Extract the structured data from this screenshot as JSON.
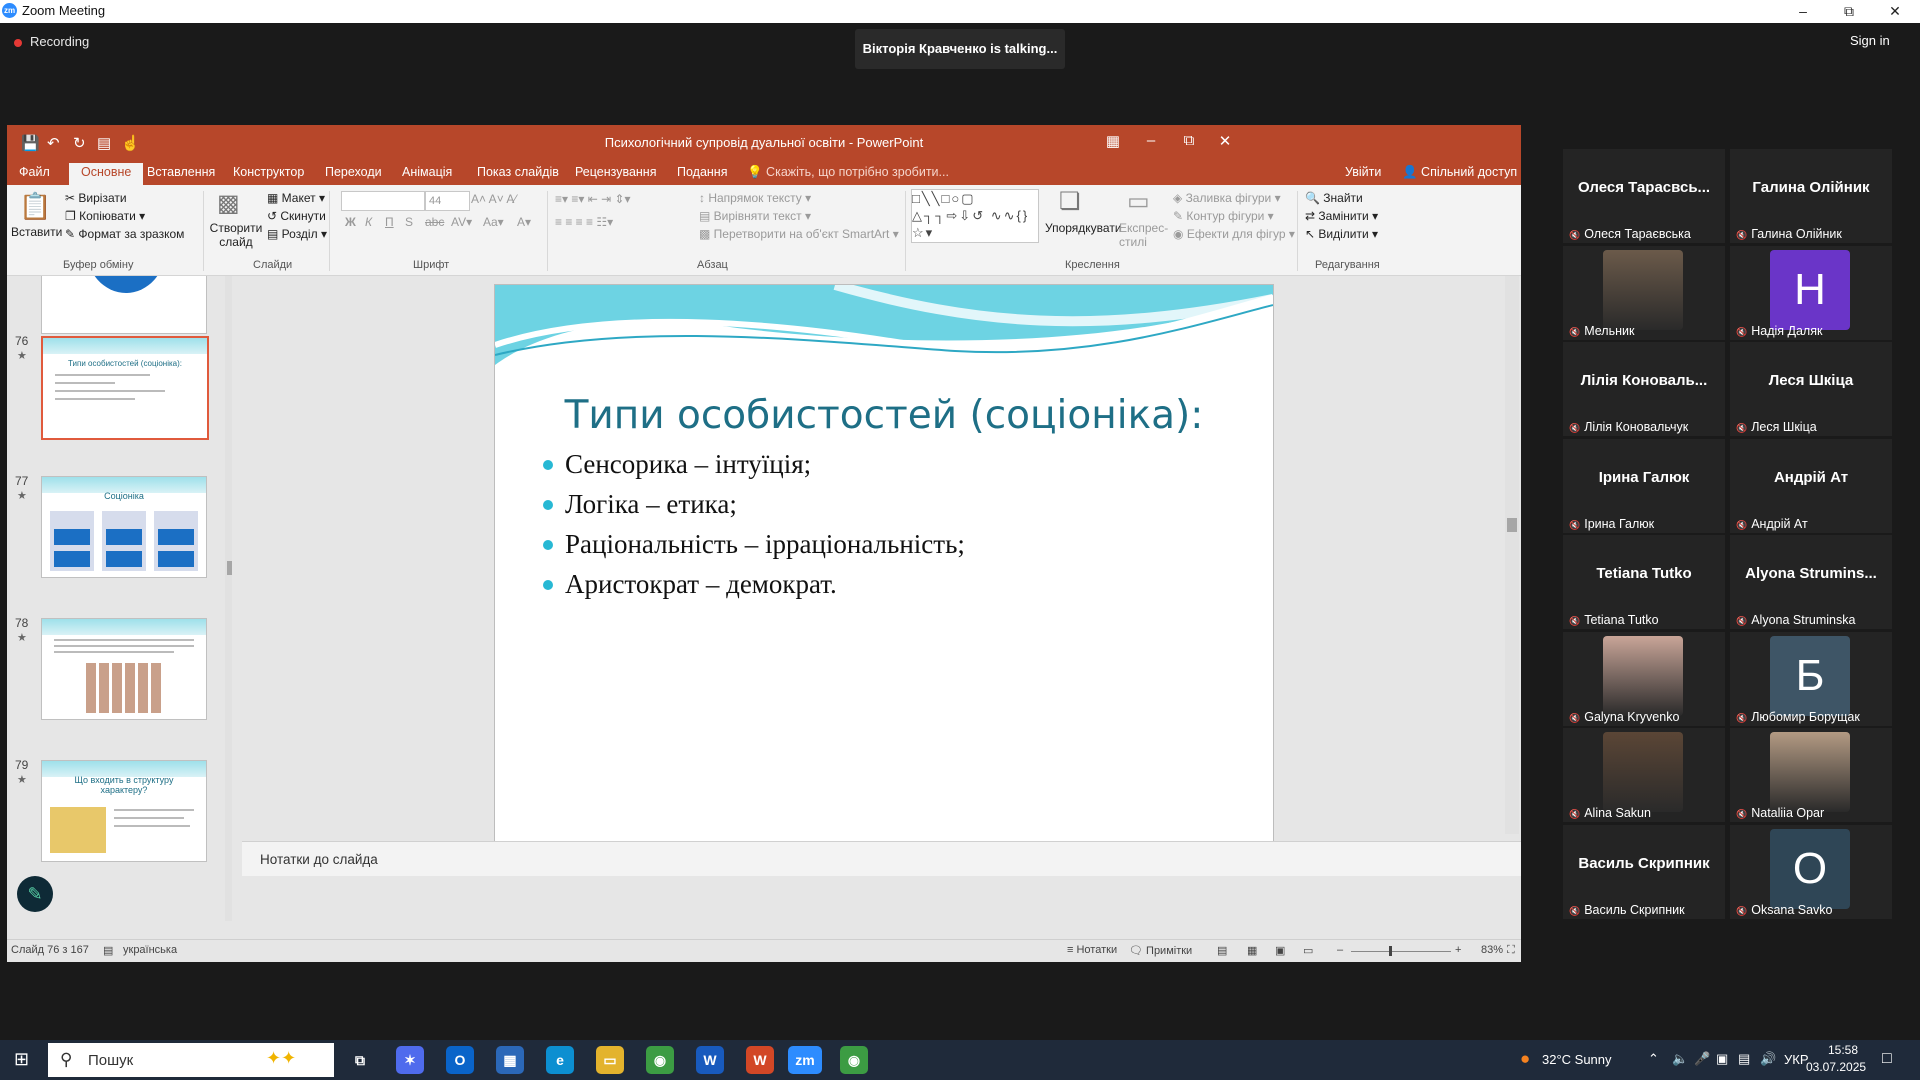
{
  "zoom": {
    "title": "Zoom Meeting",
    "logo": "zm",
    "recording": "Recording",
    "talking": "Вікторія Кравченко is talking...",
    "signin": "Sign in"
  },
  "ppt": {
    "window_title": "Психологічний супровід дуальної освіти - PowerPoint",
    "tabs": [
      "Файл",
      "Основне",
      "Вставлення",
      "Конструктор",
      "Переходи",
      "Анімація",
      "Показ слайдів",
      "Рецензування",
      "Подання"
    ],
    "active_tab": "Основне",
    "tell_me": "Скажіть, що потрібно зробити...",
    "login": "Увійти",
    "share": "Спільний доступ",
    "ribbon": {
      "paste": "Вставити",
      "cut": "Вирізати",
      "copy": "Копіювати",
      "format_painter": "Формат за зразком",
      "clipboard_group": "Буфер обміну",
      "new_slide": "Створити слайд",
      "layout": "Макет",
      "reset": "Скинути",
      "section": "Розділ",
      "slides_group": "Слайди",
      "font_size": "44",
      "font_group": "Шрифт",
      "text_direction": "Напрямок тексту",
      "align_text": "Вирівняти текст",
      "smartart": "Перетворити на об'єкт SmartArt",
      "paragraph_group": "Абзац",
      "arrange": "Упорядкувати",
      "quick_styles": "Експрес-стилі",
      "shape_fill": "Заливка фігури",
      "shape_outline": "Контур фігури",
      "shape_effects": "Ефекти для фігур",
      "drawing_group": "Креслення",
      "find": "Знайти",
      "replace": "Замінити",
      "select": "Виділити",
      "editing_group": "Редагування"
    },
    "thumbnails": [
      {
        "num": "76",
        "title": "Типи особистостей (соціоніка):"
      },
      {
        "num": "77",
        "title": "Соціоніка"
      },
      {
        "num": "78",
        "title": ""
      },
      {
        "num": "79",
        "title": "Що входить в структуру характеру?"
      }
    ],
    "slide": {
      "title": "Типи особистостей (соціоніка):",
      "bullets": [
        "Сенсорика – інтуїція;",
        "Логіка – етика;",
        "Раціональність – ірраціональність;",
        "Аристократ – демократ."
      ],
      "number": "76"
    },
    "notes_placeholder": "Нотатки до слайда",
    "status": {
      "slide_of": "Слайд 76 з 167",
      "language": "українська",
      "notes": "Нотатки",
      "comments": "Примітки",
      "zoom": "83%"
    }
  },
  "participants": [
    {
      "display": "Олеся Тарасвсь...",
      "label": "Олеся Тараєвська",
      "type": "name"
    },
    {
      "display": "Галина Олійник",
      "label": "Галина Олійник",
      "type": "name"
    },
    {
      "display": "",
      "label": "Мельник",
      "type": "photo",
      "color": "#6b5a4a"
    },
    {
      "display": "H",
      "label": "Надія Даляк",
      "type": "letter",
      "color": "#6a35c8"
    },
    {
      "display": "Лілія Коноваль...",
      "label": "Лілія Коновальчук",
      "type": "name"
    },
    {
      "display": "Леся Шкіца",
      "label": "Леся Шкіца",
      "type": "name"
    },
    {
      "display": "Ірина Галюк",
      "label": "Ірина Галюк",
      "type": "name"
    },
    {
      "display": "Андрій Ат",
      "label": "Андрій Ат",
      "type": "name"
    },
    {
      "display": "Tetiana Tutko",
      "label": "Tetiana Tutko",
      "type": "name"
    },
    {
      "display": "Alyona Strumins...",
      "label": "Alyona Struminska",
      "type": "name"
    },
    {
      "display": "",
      "label": "Galyna Kryvenko",
      "type": "photo",
      "color": "#c9a598"
    },
    {
      "display": "Б",
      "label": "Любомир Борущак",
      "type": "letter",
      "color": "#3e5566"
    },
    {
      "display": "",
      "label": "Alina Sakun",
      "type": "photo",
      "color": "#5b4636"
    },
    {
      "display": "",
      "label": "Nataliia Opar",
      "type": "photo",
      "color": "#b39a83"
    },
    {
      "display": "Василь Скрипник",
      "label": "Василь Скрипник",
      "type": "name"
    },
    {
      "display": "O",
      "label": "Oksana Savko",
      "type": "letter",
      "color": "#2f4656"
    }
  ],
  "taskbar": {
    "search": "Пошук",
    "weather": "32°C Sunny",
    "lang": "УКР",
    "time": "15:58",
    "date": "03.07.2025"
  }
}
